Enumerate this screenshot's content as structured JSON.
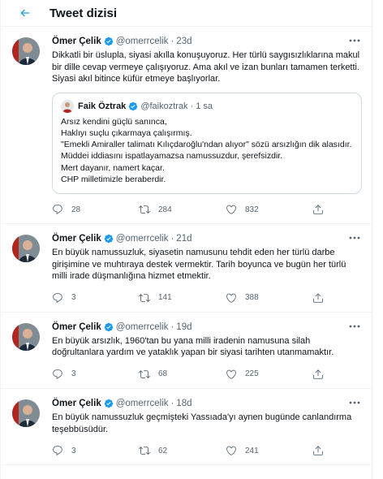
{
  "header": {
    "title": "Tweet dizisi"
  },
  "colors": {
    "accent": "#1d9bf0",
    "muted": "#536471",
    "border": "#cfd9de"
  },
  "tweets": [
    {
      "name": "Ömer Çelik",
      "handle": "@omerrcelik",
      "time": "23d",
      "text": "Dikkatli bir üslupla, siyasi akılla konuşuyoruz. Her türlü saygısızlıklarına makul bir dille cevap vermeye çalışıyoruz. Ama akıl ve izan bunları tamamen terketti. Siyasi akıl bitince küfür etmeye başlıyorlar.",
      "quote": {
        "name": "Faik Öztrak",
        "handle": "@faikoztrak",
        "time": "1 sa",
        "lines": [
          "Arsız kendini güçlü sanınca,",
          "Haklıyı suçlu çıkarmaya çalışırmış.",
          "\"Emekli Amiraller talimatı Kılıçdaroğlu'ndan alıyor\" sözü arsızlığın dik alasıdır.",
          "Müddei iddiasını ispatlayamazsa namussuzdur, şerefsizdir.",
          "Mert dayanır, namert kaçar.",
          "CHP milletimizle beraberdir."
        ]
      },
      "replies": "28",
      "retweets": "284",
      "likes": "832"
    },
    {
      "name": "Ömer Çelik",
      "handle": "@omerrcelik",
      "time": "21d",
      "text": "En büyük namussuzluk, siyasetin namusunu tehdit eden her türlü darbe girişimine ve muhtıraya destek vermektir. Tarih boyunca ve bugün her türlü milli irade düşmanlığına hizmet etmektir.",
      "replies": "3",
      "retweets": "141",
      "likes": "388"
    },
    {
      "name": "Ömer Çelik",
      "handle": "@omerrcelik",
      "time": "19d",
      "text": "En büyük arsızlık, 1960'tan bu yana milli iradenin namusuna silah doğrultanlara yardım ve yataklık yapan bir siyasi tarihten utanmamaktır.",
      "replies": "3",
      "retweets": "68",
      "likes": "225"
    },
    {
      "name": "Ömer Çelik",
      "handle": "@omerrcelik",
      "time": "18d",
      "text": "En büyük namussuzluk geçmişteki Yassıada'yı aynen bugünde canlandırma teşebbüsüdür.",
      "replies": "3",
      "retweets": "62",
      "likes": "241"
    }
  ]
}
